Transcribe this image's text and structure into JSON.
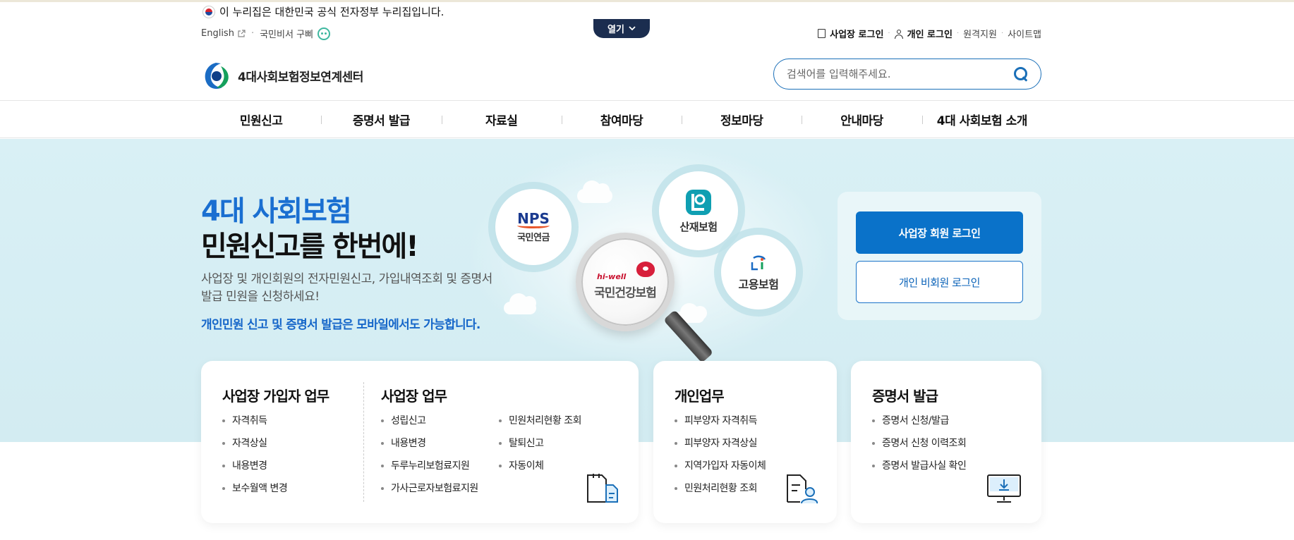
{
  "gov_banner": {
    "text": "이 누리집은 대한민국 공식 전자정부 누리집입니다."
  },
  "toggle": {
    "label": "열기"
  },
  "util_left": {
    "english": "English",
    "chatbot": "국민비서 구삐"
  },
  "util_right": {
    "business_login": "사업장 로그인",
    "personal_login": "개인 로그인",
    "remote": "원격지원",
    "sitemap": "사이트맵"
  },
  "logo": {
    "text": "4대사회보험정보연계센터"
  },
  "search": {
    "placeholder": "검색어를 입력해주세요."
  },
  "nav": {
    "items": [
      "민원신고",
      "증명서 발급",
      "자료실",
      "참여마당",
      "정보마당",
      "안내마당",
      "4대 사회보험 소개"
    ]
  },
  "hero": {
    "title_line1": "4대 사회보험",
    "title_line2": "민원신고를 한번에!",
    "desc": "사업장 및 개인회원의 전자민원신고, 가입내역조회 및 증명서 발급 민원을 신청하세요!",
    "note": "개인민원 신고 및 증명서 발급은 모바일에서도 가능합니다."
  },
  "insurers": {
    "nps_logo": "NPS",
    "nps_label": "국민연금",
    "comwel_label": "산재보험",
    "ei_label": "고용보험",
    "nhis_brand": "hi-well",
    "nhis_label": "국민건강보험"
  },
  "login": {
    "business_member": "사업장 회원 로그인",
    "personal_nonmember": "개인 비회원 로그인"
  },
  "colors": {
    "accent": "#0a72c9",
    "hero_bg": "#d9f0f5",
    "nav_divider": "#cccccc"
  },
  "cards": {
    "subscriber": {
      "title": "사업장 가입자 업무",
      "items": [
        "자격취득",
        "자격상실",
        "내용변경",
        "보수월액 변경"
      ]
    },
    "business": {
      "title": "사업장 업무",
      "col1": [
        "성립신고",
        "내용변경",
        "두루누리보험료지원",
        "가사근로자보험료지원"
      ],
      "col2": [
        "민원처리현황 조회",
        "탈퇴신고",
        "자동이체"
      ]
    },
    "personal": {
      "title": "개인업무",
      "items": [
        "피부양자 자격취득",
        "피부양자 자격상실",
        "지역가입자 자동이체",
        "민원처리현황 조회"
      ]
    },
    "certificate": {
      "title": "증명서 발급",
      "items": [
        "증명서 신청/발급",
        "증명서 신청 이력조회",
        "증명서 발급사실 확인"
      ]
    }
  },
  "icons": [
    "external-link-icon",
    "chatbot-icon",
    "building-icon",
    "person-icon",
    "search-icon",
    "chevron-down-icon",
    "documents-icon",
    "person-document-icon",
    "monitor-download-icon"
  ]
}
